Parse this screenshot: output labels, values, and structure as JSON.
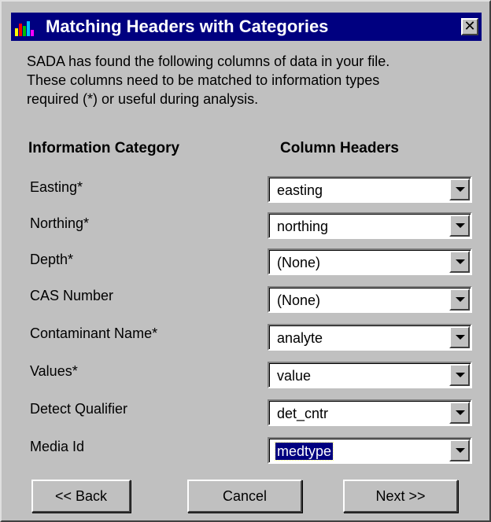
{
  "window": {
    "title": "Matching Headers with Categories",
    "close_glyph": "✕"
  },
  "intro": {
    "line1": "SADA has found the following columns of data in your file.",
    "line2": "These columns need to be matched to information types",
    "line3": "required (*) or  useful during analysis."
  },
  "headers": {
    "category": "Information Category",
    "column": "Column Headers"
  },
  "rows": [
    {
      "label": "Easting*",
      "value": "easting"
    },
    {
      "label": "Northing*",
      "value": "northing"
    },
    {
      "label": "Depth*",
      "value": "(None)"
    },
    {
      "label": "CAS Number",
      "value": "(None)"
    },
    {
      "label": "Contaminant Name*",
      "value": "analyte"
    },
    {
      "label": "Values*",
      "value": "value"
    },
    {
      "label": "Detect Qualifier",
      "value": "det_cntr"
    },
    {
      "label": "Media Id",
      "value": "medtype"
    }
  ],
  "buttons": {
    "back": "<< Back",
    "cancel": "Cancel",
    "next": "Next >>"
  },
  "colors": {
    "titlebar": "#000080",
    "face": "#c0c0c0",
    "selection": "#000080"
  },
  "icons": [
    "bar-chart-app-icon",
    "close-icon",
    "dropdown-arrow-icon"
  ]
}
